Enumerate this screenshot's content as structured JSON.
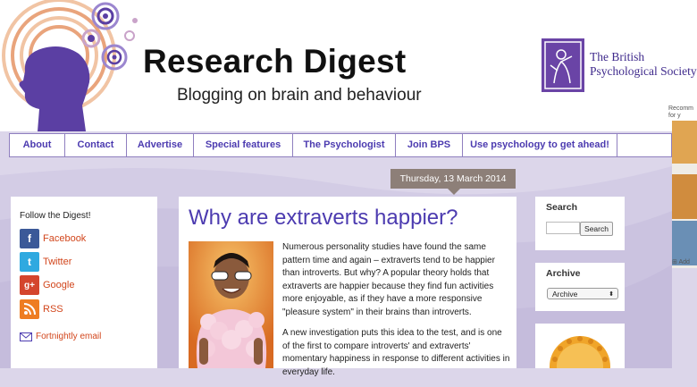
{
  "header": {
    "title": "Research Digest",
    "tagline": "Blogging on brain and behaviour",
    "bps_line1": "The British",
    "bps_line2": "Psychological Society",
    "side_ad_line1": "Recomm",
    "side_ad_line2": "for y"
  },
  "nav": {
    "items": [
      {
        "label": "About"
      },
      {
        "label": "Contact"
      },
      {
        "label": "Advertise"
      },
      {
        "label": "Special features"
      },
      {
        "label": "The Psychologist"
      },
      {
        "label": "Join BPS"
      },
      {
        "label": "Use psychology to get ahead!"
      }
    ]
  },
  "sidebar_left": {
    "title": "Follow the Digest!",
    "links": [
      {
        "label": "Facebook",
        "icon": "facebook-icon",
        "color": "#3b5998"
      },
      {
        "label": "Twitter",
        "icon": "twitter-icon",
        "color": "#2fa9e0"
      },
      {
        "label": "Google",
        "icon": "google-plus-icon",
        "color": "#d4452d"
      },
      {
        "label": "RSS",
        "icon": "rss-icon",
        "color": "#ee7d22"
      }
    ],
    "email_label": "Fortnightly email"
  },
  "post": {
    "date": "Thursday, 13 March 2014",
    "title": "Why are extraverts happier?",
    "paragraph1": "Numerous personality studies have found the same pattern time and again – extraverts tend to be happier than introverts. But why? A popular theory holds that extraverts are happier because they find fun activities more enjoyable, as if they have a more responsive \"pleasure system\" in their brains than introverts.",
    "paragraph2": "A new investigation puts this idea to the test, and is one of the first to compare introverts' and extraverts' momentary happiness in response to different activities in everyday life."
  },
  "sidebar_right": {
    "search_title": "Search",
    "search_button": "Search",
    "search_value": "",
    "archive_title": "Archive",
    "archive_selected": "Archive"
  },
  "right_edge": {
    "add_label": "Add"
  },
  "colors": {
    "accent": "#4c3bb0",
    "link": "#d2461c",
    "background": "#dcd6ea",
    "bps_purple": "#6a44a6"
  }
}
